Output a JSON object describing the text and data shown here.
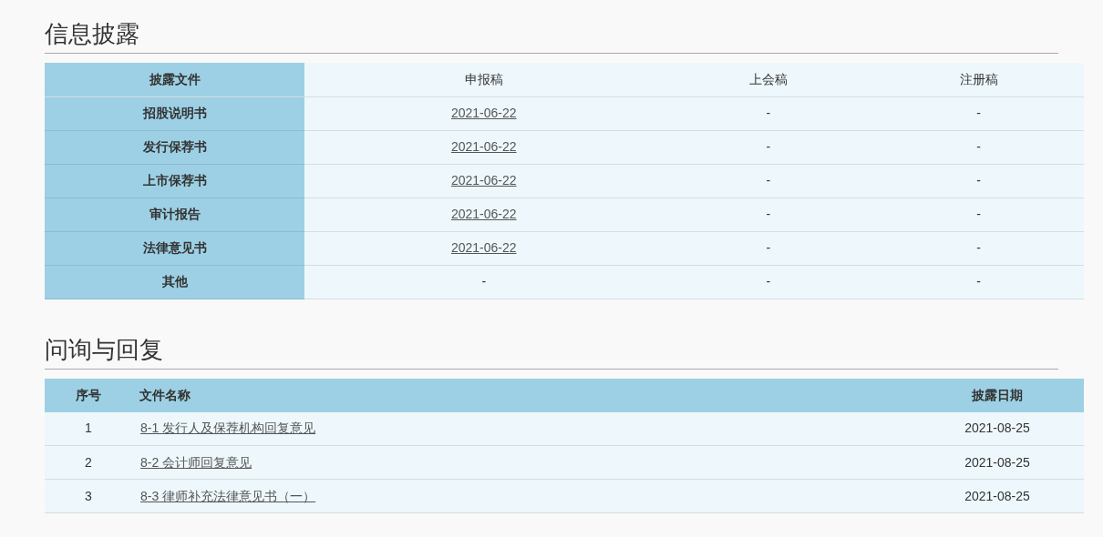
{
  "disclosure": {
    "title": "信息披露",
    "columns": [
      "披露文件",
      "申报稿",
      "上会稿",
      "注册稿"
    ],
    "rows": [
      {
        "cells": [
          {
            "text": "招股说明书",
            "kind": "header"
          },
          {
            "text": "2021-06-22",
            "kind": "link"
          },
          {
            "text": "-",
            "kind": "text"
          },
          {
            "text": "-",
            "kind": "text"
          }
        ]
      },
      {
        "cells": [
          {
            "text": "发行保荐书",
            "kind": "header"
          },
          {
            "text": "2021-06-22",
            "kind": "link"
          },
          {
            "text": "-",
            "kind": "text"
          },
          {
            "text": "-",
            "kind": "text"
          }
        ]
      },
      {
        "cells": [
          {
            "text": "上市保荐书",
            "kind": "header"
          },
          {
            "text": "2021-06-22",
            "kind": "link"
          },
          {
            "text": "-",
            "kind": "text"
          },
          {
            "text": "-",
            "kind": "text"
          }
        ]
      },
      {
        "cells": [
          {
            "text": "审计报告",
            "kind": "header"
          },
          {
            "text": "2021-06-22",
            "kind": "link"
          },
          {
            "text": "-",
            "kind": "text"
          },
          {
            "text": "-",
            "kind": "text"
          }
        ]
      },
      {
        "cells": [
          {
            "text": "法律意见书",
            "kind": "header"
          },
          {
            "text": "2021-06-22",
            "kind": "link"
          },
          {
            "text": "-",
            "kind": "text"
          },
          {
            "text": "-",
            "kind": "text"
          }
        ]
      },
      {
        "cells": [
          {
            "text": "其他",
            "kind": "header"
          },
          {
            "text": "-",
            "kind": "text"
          },
          {
            "text": "-",
            "kind": "text"
          },
          {
            "text": "-",
            "kind": "text"
          }
        ]
      }
    ]
  },
  "inquiry": {
    "title": "问询与回复",
    "columns": [
      "序号",
      "文件名称",
      "披露日期"
    ],
    "rows": [
      {
        "no": "1",
        "file": "8-1 发行人及保荐机构回复意见",
        "date": "2021-08-25"
      },
      {
        "no": "2",
        "file": "8-2 会计师回复意见",
        "date": "2021-08-25"
      },
      {
        "no": "3",
        "file": "8-3 律师补充法律意见书（一）",
        "date": "2021-08-25"
      }
    ]
  }
}
